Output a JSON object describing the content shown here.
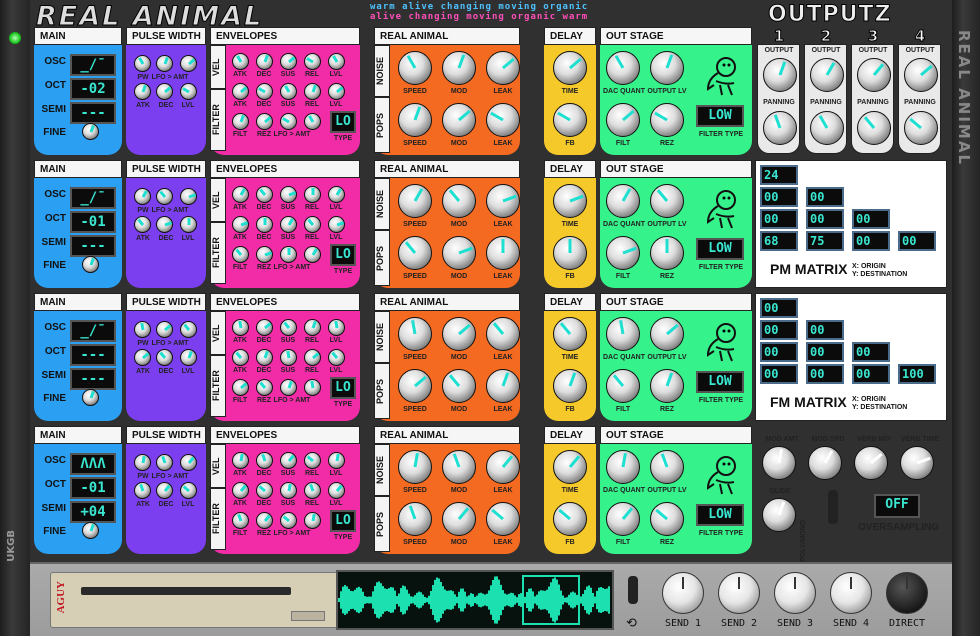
{
  "app": {
    "title": "REAL ANIMAL",
    "tagline1": "warm alive changing moving organic",
    "tagline2": "alive changing moving organic warm",
    "outputs_title": "OUTPUTZ",
    "vertical_brand": "REAL ANIMAL",
    "left_brand": "UKGB",
    "foot_logo": "AGUY"
  },
  "colors": {
    "main": "#2b9ff2",
    "pulse": "#7b3ff0",
    "env": "#f22ba7",
    "animal": "#f36a20",
    "delay": "#f6c92a",
    "out": "#36f28b",
    "teal": "#1de0d0"
  },
  "labels": {
    "main": "MAIN",
    "pulse": "PULSE WIDTH",
    "env": "ENVELOPES",
    "animal": "REAL ANIMAL",
    "delay": "DELAY",
    "out": "OUT STAGE",
    "osc": "OSC",
    "oct": "OCT",
    "semi": "SEMI",
    "fine": "FINE",
    "vel": "VEL",
    "filter": "FILTER",
    "noise": "NOISE",
    "pops": "POPS",
    "pw": "PW",
    "lfo_amt": "LFO > AMT",
    "atk": "ATK",
    "dec": "DEC",
    "lvl": "LVL",
    "sus": "SUS",
    "rel": "REL",
    "filt": "FILT",
    "rez": "REZ",
    "type": "TYPE",
    "speed": "SPEED",
    "mod": "MOD",
    "leak": "LEAK",
    "time": "TIME",
    "fb": "FB",
    "dac": "DAC QUANT",
    "outlv": "OUTPUT LV",
    "filter_type": "FILTER TYPE"
  },
  "rows": [
    {
      "osc": "_/¯",
      "oct": "-02",
      "semi": "---",
      "env_type": "LO",
      "filter_type": "LOW"
    },
    {
      "osc": "_/¯",
      "oct": "-01",
      "semi": "---",
      "env_type": "LO",
      "filter_type": "LOW"
    },
    {
      "osc": "_/¯",
      "oct": "---",
      "semi": "---",
      "env_type": "LO",
      "filter_type": "LOW"
    },
    {
      "osc": "ΛΛΛ",
      "oct": "-01",
      "semi": "+04",
      "env_type": "LO",
      "filter_type": "LOW"
    }
  ],
  "outputs": {
    "nums": [
      "1",
      "2",
      "3",
      "4"
    ],
    "output_label": "OUTPUT",
    "panning_label": "PANNING",
    "main_out": "MAIN OUT"
  },
  "pm": {
    "title": "PM MATRIX",
    "sub1": "X: ORIGIN",
    "sub2": "Y: DESTINATION",
    "cells": [
      [
        "24"
      ],
      [
        "00",
        "00"
      ],
      [
        "00",
        "00",
        "00"
      ],
      [
        "68",
        "75",
        "00",
        "00"
      ]
    ]
  },
  "fm": {
    "title": "FM MATRIX",
    "sub1": "X: ORIGIN",
    "sub2": "Y: DESTINATION",
    "cells": [
      [
        "00"
      ],
      [
        "00",
        "00"
      ],
      [
        "00",
        "00",
        "00"
      ],
      [
        "00",
        "00",
        "00",
        "100"
      ]
    ]
  },
  "global": {
    "mod_amt": "MOD AMT",
    "mod_spd": "MOD SPD",
    "verb_mix": "VERB MIX",
    "verb_time": "VERB TIME",
    "glide": "GLIDE",
    "polymono": "POLY/MONO",
    "oversampling": "OVERSAMPLING",
    "os_value": "OFF"
  },
  "sends": [
    "SEND 1",
    "SEND 2",
    "SEND 3",
    "SEND 4",
    "DIRECT"
  ]
}
